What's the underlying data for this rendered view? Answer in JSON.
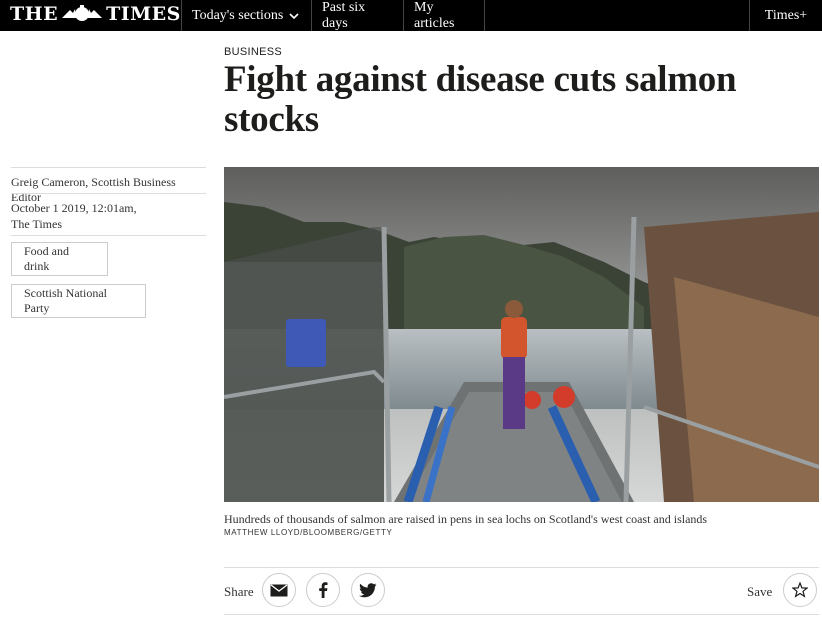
{
  "topbar": {
    "logo_left": "THE",
    "logo_right": "TIMES",
    "nav": [
      "Today's sections",
      "Past six days",
      "My articles"
    ],
    "times_plus": "Times+"
  },
  "article": {
    "section": "BUSINESS",
    "headline": "Fight against disease cuts salmon stocks",
    "byline": "Greig Cameron, Scottish Business Editor",
    "date": "October 1 2019, 12:01am,",
    "publication": "The Times",
    "tags": [
      "Food and drink",
      "Scottish National Party"
    ]
  },
  "image": {
    "caption": "Hundreds of thousands of salmon are raised in pens in sea lochs on Scotland's west coast and islands",
    "credit": "MATTHEW LLOYD/BLOOMBERG/GETTY"
  },
  "share": {
    "label": "Share",
    "save_label": "Save",
    "icons": [
      "mail-icon",
      "facebook-icon",
      "twitter-icon",
      "star-icon"
    ]
  }
}
